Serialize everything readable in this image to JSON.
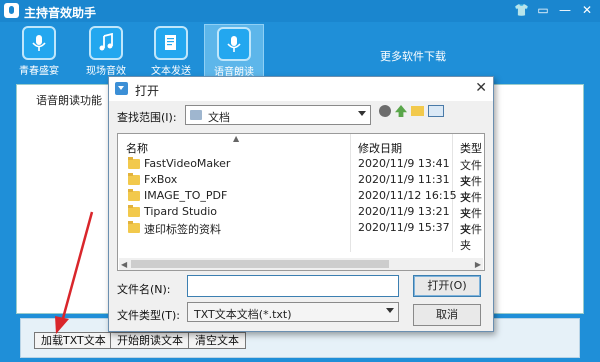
{
  "app": {
    "title": "主持音效助手",
    "more_link": "更多软件下载",
    "tools": [
      {
        "label": "青春盛宴",
        "icon": "microphone-icon"
      },
      {
        "label": "现场音效",
        "icon": "music-note-icon"
      },
      {
        "label": "文本发送",
        "icon": "document-icon"
      },
      {
        "label": "语音朗读",
        "icon": "microphone-icon"
      }
    ],
    "active_tool": "语音朗读",
    "panel_label": "语音朗读功能",
    "buttons": {
      "load_txt": "加载TXT文本",
      "start_read": "开始朗读文本",
      "clear": "清空文本"
    }
  },
  "dialog": {
    "title": "打开",
    "look_in_label": "查找范围(I):",
    "look_in_value": "文档",
    "columns": {
      "name": "名称",
      "date": "修改日期",
      "type": "类型"
    },
    "files": [
      {
        "name": "FastVideoMaker",
        "date": "2020/11/9 13:41",
        "type": "文件夹"
      },
      {
        "name": "FxBox",
        "date": "2020/11/9 11:31",
        "type": "文件夹"
      },
      {
        "name": "IMAGE_TO_PDF",
        "date": "2020/11/12 16:15",
        "type": "文件夹"
      },
      {
        "name": "Tipard Studio",
        "date": "2020/11/9 13:21",
        "type": "文件夹"
      },
      {
        "name": "速印标签的资料",
        "date": "2020/11/9 15:37",
        "type": "文件夹"
      }
    ],
    "filename_label": "文件名(N):",
    "filename_value": "",
    "filetype_label": "文件类型(T):",
    "filetype_value": "TXT文本文档(*.txt)",
    "open_button": "打开(O)",
    "cancel_button": "取消"
  },
  "colors": {
    "app_blue": "#1f8fd8",
    "annotation_arrow": "#d9262b"
  }
}
